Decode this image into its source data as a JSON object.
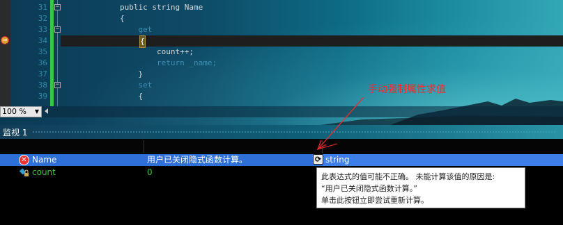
{
  "editor": {
    "line_numbers": [
      "31",
      "32",
      "33",
      "34",
      "35",
      "36",
      "37",
      "38",
      "39"
    ],
    "code_lines": [
      "public string Name",
      "{",
      "    get",
      "    {",
      "        count++;",
      "        return _name;",
      "    }",
      "    set",
      "    {"
    ],
    "zoom": "100 %"
  },
  "annotation": {
    "text": "手动强制属性求值"
  },
  "watch": {
    "title": "监视 1",
    "rows": [
      {
        "name": "Name",
        "value": "用户已关闭隐式函数计算。",
        "type": "string",
        "icon": "error-icon",
        "selected": true
      },
      {
        "name": "count",
        "value": "0",
        "type": "",
        "icon": "field-icon",
        "selected": false
      }
    ],
    "tooltip": {
      "line1": "此表达式的值可能不正确。      未能计算该值的原因是:",
      "line2": "“用户已关闭隐式函数计算。”",
      "line3": "单击此按钮立即尝试重新计算。"
    }
  },
  "colors": {
    "accent_selection": "#2f6fd8",
    "annotation_red": "#ee2b2b",
    "change_bar": "#35c748"
  }
}
